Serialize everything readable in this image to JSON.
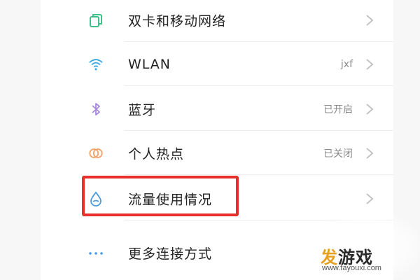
{
  "settings": {
    "items": [
      {
        "label": "双卡和移动网络",
        "status": "",
        "icon": "dual-sim-icon"
      },
      {
        "label": "WLAN",
        "status": "jxf",
        "icon": "wifi-icon"
      },
      {
        "label": "蓝牙",
        "status": "已开启",
        "icon": "bluetooth-icon"
      },
      {
        "label": "个人热点",
        "status": "已关闭",
        "icon": "hotspot-icon"
      },
      {
        "label": "流量使用情况",
        "status": "",
        "icon": "data-usage-icon"
      },
      {
        "label": "更多连接方式",
        "status": "",
        "icon": "more-icon"
      }
    ]
  },
  "watermark": {
    "part1": "发",
    "part2": "游戏",
    "url": "www.fayouxi.com"
  },
  "colors": {
    "highlight": "#e8302a",
    "dual_sim": "#3fbf8a",
    "wifi": "#3fa9e0",
    "bluetooth": "#a98ad9",
    "hotspot": "#f2a36b",
    "data_usage": "#4a9be0",
    "more": "#4a9be0"
  }
}
